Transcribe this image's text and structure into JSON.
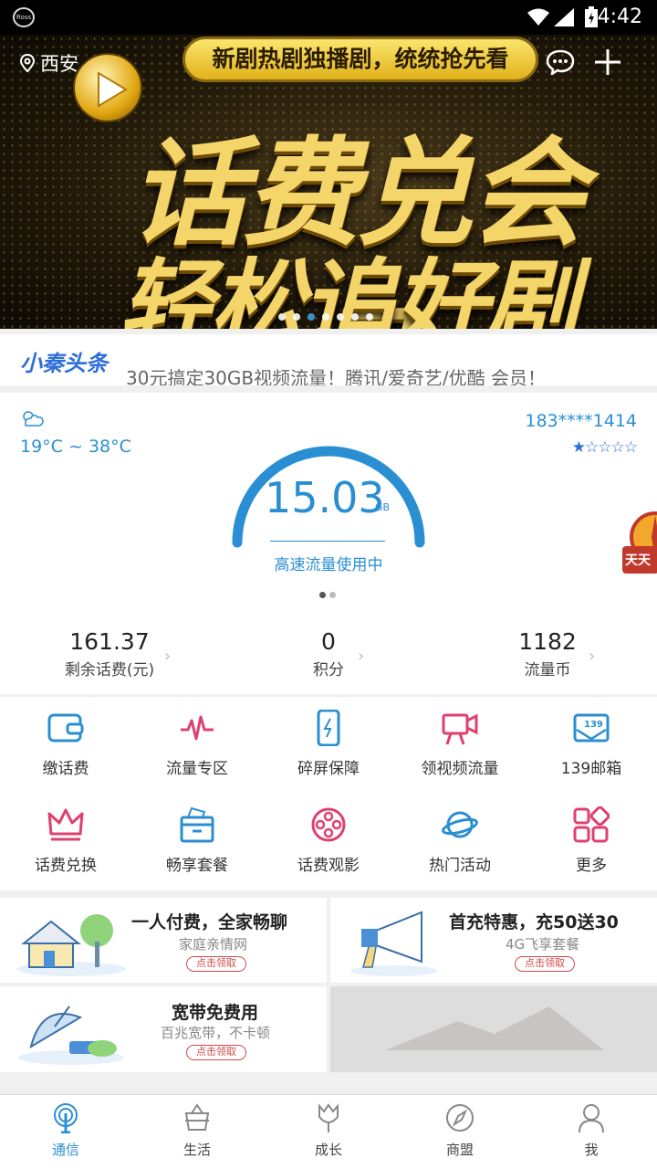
{
  "status_bar": {
    "time": "4:42",
    "app_badge": "Ross"
  },
  "banner": {
    "city": "西安",
    "pill_text": "新剧热剧独播剧，统统抢先看",
    "headline_1": "话费兑会员",
    "headline_2": "轻松追好剧",
    "active_dot": 2,
    "dot_count": 7
  },
  "news": {
    "logo": "小秦头条",
    "headline": "30元搞定30GB视频流量！腾讯/爱奇艺/优酷 会员！"
  },
  "panel": {
    "temperature": "19°C ~ 38°C",
    "phone": "183****1414",
    "stars": "★☆☆☆☆",
    "rating": 1,
    "gauge_value": "15.03",
    "gauge_unit": "GB",
    "gauge_label": "高速流量使用中",
    "stats": [
      {
        "value": "161.37",
        "label": "剩余话费(元)"
      },
      {
        "value": "0",
        "label": "积分"
      },
      {
        "value": "1182",
        "label": "流量币"
      }
    ]
  },
  "float_badge": {
    "text": "天天"
  },
  "services": [
    {
      "label": "缴话费",
      "icon": "wallet-icon",
      "color": "#2a8fd2"
    },
    {
      "label": "流量专区",
      "icon": "pulse-icon",
      "color": "#e0406e"
    },
    {
      "label": "碎屏保障",
      "icon": "phone-icon",
      "color": "#2a8fd2"
    },
    {
      "label": "领视频流量",
      "icon": "video-camera-icon",
      "color": "#e0406e"
    },
    {
      "label": "139邮箱",
      "icon": "mail-139-icon",
      "color": "#2a8fd2",
      "badge": "139"
    },
    {
      "label": "话费兑换",
      "icon": "crown-icon",
      "color": "#e0406e"
    },
    {
      "label": "畅享套餐",
      "icon": "box-icon",
      "color": "#2a8fd2"
    },
    {
      "label": "话费观影",
      "icon": "film-reel-icon",
      "color": "#e0406e"
    },
    {
      "label": "热门活动",
      "icon": "planet-icon",
      "color": "#2a8fd2"
    },
    {
      "label": "更多",
      "icon": "more-grid-icon",
      "color": "#e0406e"
    }
  ],
  "promos": [
    {
      "title": "一人付费，全家畅聊",
      "subtitle": "家庭亲情网",
      "button": "点击领取"
    },
    {
      "title": "首充特惠，充50送30",
      "subtitle": "4G飞享套餐",
      "button": "点击领取"
    },
    {
      "title": "宽带免费用",
      "subtitle": "百兆宽带，不卡顿",
      "button": "点击领取"
    }
  ],
  "tabs": [
    {
      "label": "通信",
      "icon": "signal-tower-icon",
      "active": true
    },
    {
      "label": "生活",
      "icon": "basket-icon",
      "active": false
    },
    {
      "label": "成长",
      "icon": "tulip-icon",
      "active": false
    },
    {
      "label": "商盟",
      "icon": "compass-icon",
      "active": false
    },
    {
      "label": "我",
      "icon": "user-icon",
      "active": false
    }
  ],
  "colors": {
    "accent": "#2a8fd2",
    "pink": "#e0406e",
    "gold": "#f4d56a"
  }
}
